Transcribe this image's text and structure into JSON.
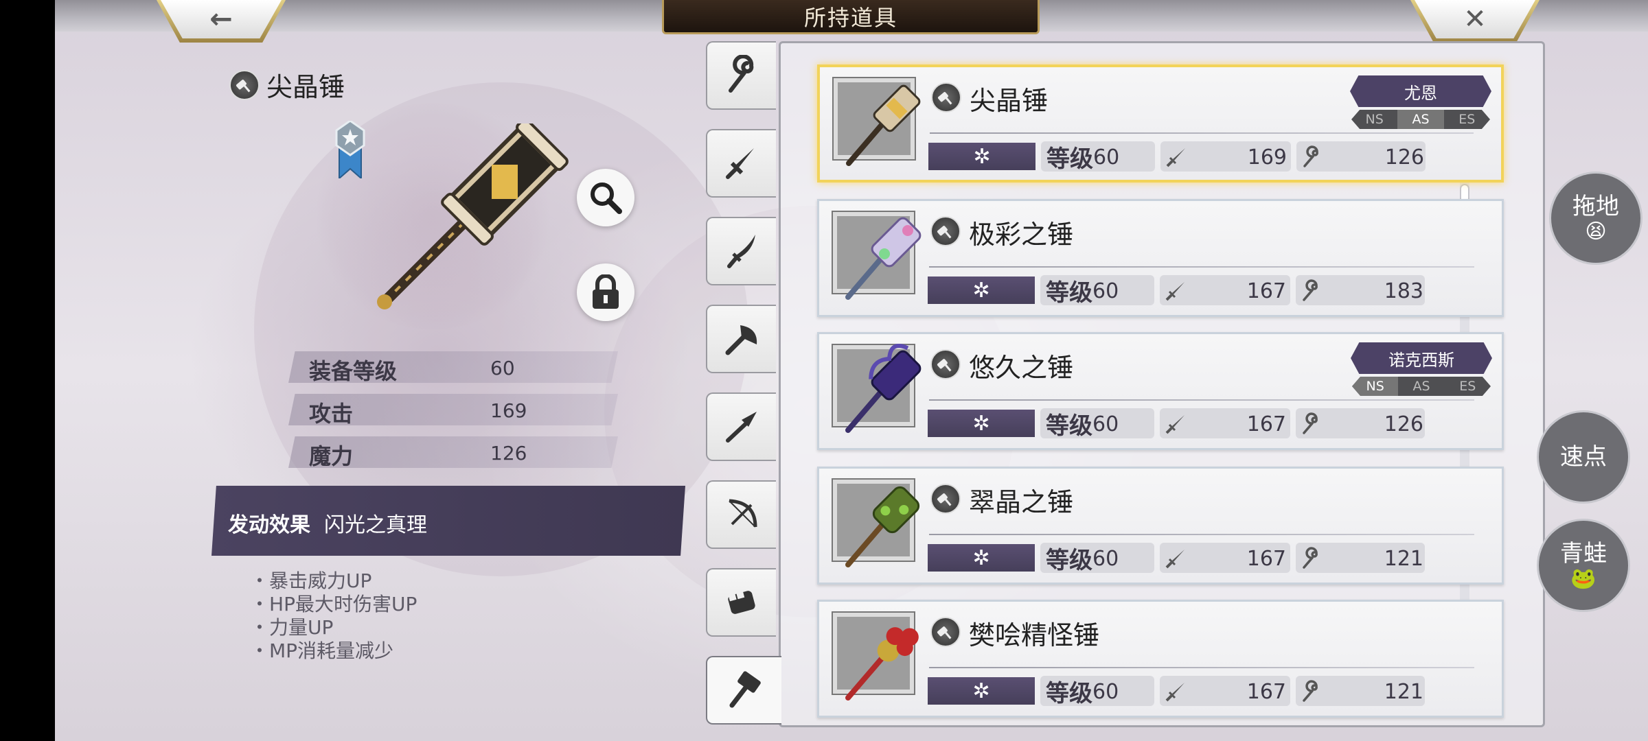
{
  "header": {
    "title": "所持道具",
    "back_glyph": "←",
    "close_glyph": "✕"
  },
  "detail": {
    "name": "尖晶锤",
    "stats": [
      {
        "label": "装备等级",
        "value": "60"
      },
      {
        "label": "攻击",
        "value": "169"
      },
      {
        "label": "魔力",
        "value": "126"
      }
    ],
    "effect_label": "发动效果",
    "effect_name": "闪光之真理",
    "effects": [
      "暴击威力UP",
      "HP最大时伤害UP",
      "力量UP",
      "MP消耗量减少"
    ]
  },
  "tabs": [
    "staff-icon",
    "sword-icon",
    "katana-icon",
    "axe-icon",
    "spear-icon",
    "bow-icon",
    "fist-icon",
    "hammer-icon"
  ],
  "list": {
    "level_label": "等级",
    "items": [
      {
        "name": "尖晶锤",
        "level": "60",
        "atk": "169",
        "mag": "126",
        "character": "尤恩",
        "tags": [
          "NS",
          "AS",
          "ES"
        ],
        "active_tag": "AS"
      },
      {
        "name": "极彩之锤",
        "level": "60",
        "atk": "167",
        "mag": "183"
      },
      {
        "name": "悠久之锤",
        "level": "60",
        "atk": "167",
        "mag": "126",
        "character": "诺克西斯",
        "tags": [
          "NS",
          "AS",
          "ES"
        ],
        "active_tag": "NS"
      },
      {
        "name": "翠晶之锤",
        "level": "60",
        "atk": "167",
        "mag": "121"
      },
      {
        "name": "樊哙精怪锤",
        "level": "60",
        "atk": "167",
        "mag": "121"
      }
    ]
  },
  "side_buttons": [
    {
      "label": "拖地",
      "emoji": "😫"
    },
    {
      "label": "速点",
      "emoji": ""
    },
    {
      "label": "青蛙",
      "emoji": "🐸"
    }
  ],
  "colors": {
    "accent": "#4b4360",
    "gold": "#f2d35a"
  }
}
